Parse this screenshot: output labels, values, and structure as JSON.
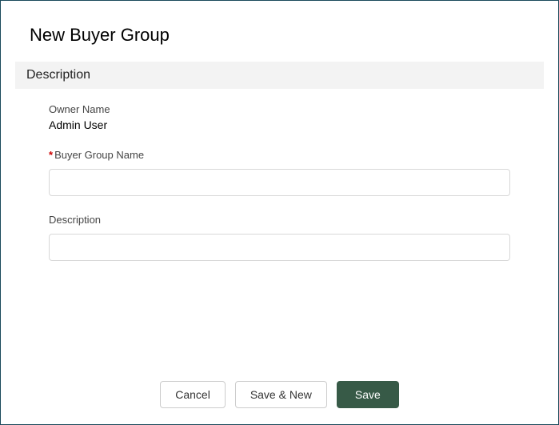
{
  "dialog": {
    "title": "New Buyer Group",
    "section_heading": "Description"
  },
  "fields": {
    "owner": {
      "label": "Owner Name",
      "value": "Admin User"
    },
    "buyer_group_name": {
      "label": "Buyer Group Name",
      "value": ""
    },
    "description": {
      "label": "Description",
      "value": ""
    },
    "required_mark": "*"
  },
  "buttons": {
    "cancel": "Cancel",
    "save_and_new": "Save & New",
    "save": "Save"
  }
}
